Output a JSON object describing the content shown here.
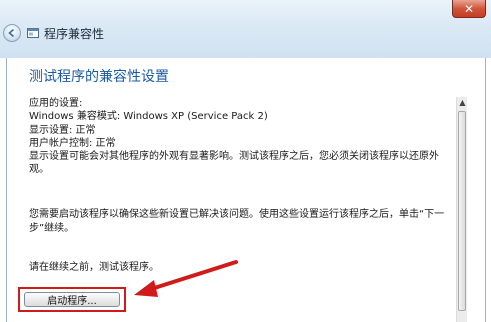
{
  "window": {
    "title": "程序兼容性",
    "close_glyph": "✕"
  },
  "content": {
    "heading": "测试程序的兼容性设置",
    "applied_settings_label": "应用的设置:",
    "compat_mode": "Windows 兼容模式: Windows XP (Service Pack 2)",
    "display_settings": "显示设置: 正常",
    "uac": "用户帐户控制: 正常",
    "warning": "显示设置可能会对其他程序的外观有显著影响。测试该程序之后，您必须关闭该程序以还原外观。",
    "instruction": "您需要启动该程序以确保这些新设置已解决该问题。使用这些设置运行该程序之后，单击“下一步”继续。",
    "test_prompt": "请在继续之前，测试该程序。"
  },
  "actions": {
    "start_program_label": "启动程序..."
  },
  "colors": {
    "heading": "#1b5aa0",
    "annotation_red": "#d11a1a"
  },
  "icons": [
    "back-arrow-icon",
    "app-window-icon",
    "close-icon",
    "scroll-up-arrow-icon"
  ]
}
